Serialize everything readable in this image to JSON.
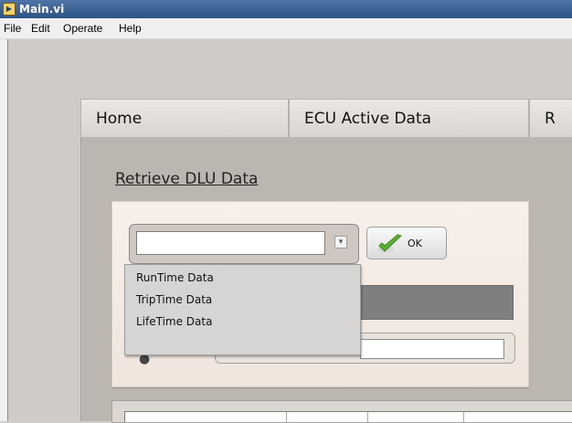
{
  "window": {
    "title": "Main.vi",
    "app_icon": "labview-vi-icon"
  },
  "menu": {
    "items": [
      "File",
      "Edit",
      "Operate",
      "Help"
    ]
  },
  "tabs": [
    {
      "label": "Home"
    },
    {
      "label": "ECU Active Data"
    },
    {
      "label": "R"
    }
  ],
  "section": {
    "title": "Retrieve DLU Data"
  },
  "combo": {
    "value": "",
    "arrow_icon": "dropdown-arrow-icon"
  },
  "ok_button": {
    "label": "OK",
    "icon": "checkmark-icon",
    "icon_color": "#5cae2f"
  },
  "dropdown": {
    "options": [
      "RunTime Data",
      "TripTime Data",
      "LifeTime Data"
    ]
  },
  "colors": {
    "title_bar": "#2c5487",
    "panel": "#cfcbc8",
    "tab_body": "#bcb6b1",
    "cream_panel": "#f7f0ea",
    "indicator_bar": "#7f7f7f"
  }
}
